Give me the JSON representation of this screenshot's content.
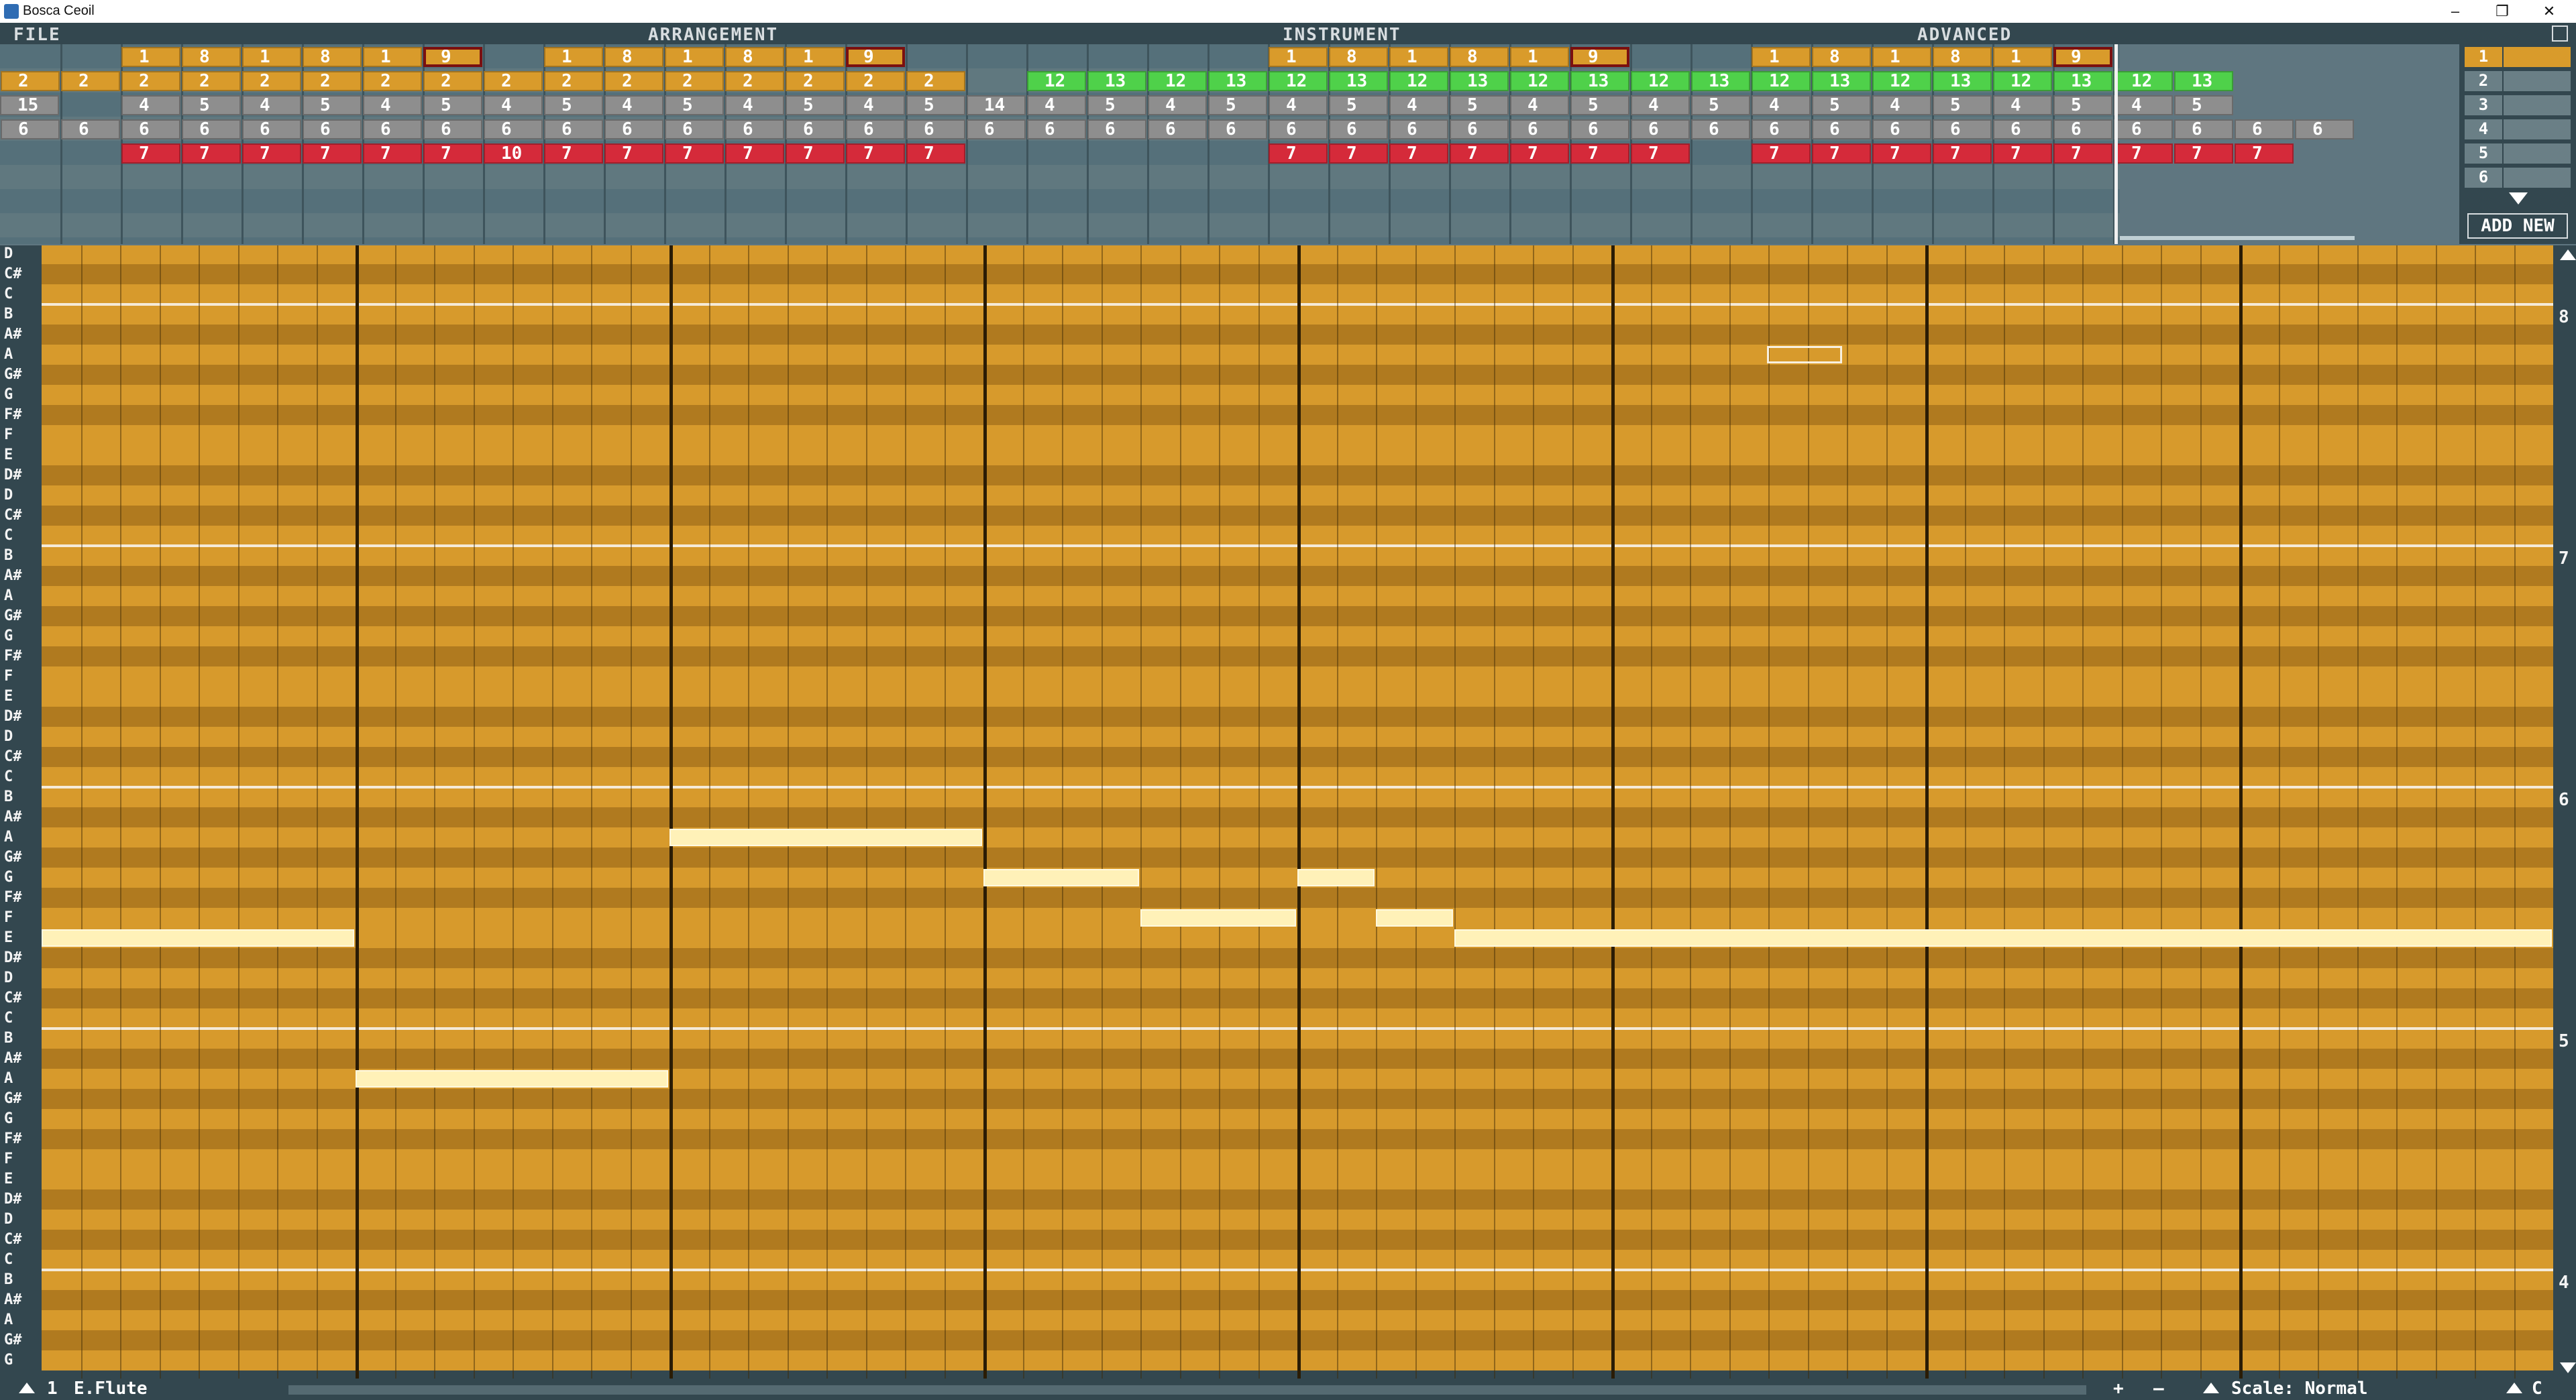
{
  "window": {
    "title": "Bosca Ceoil",
    "minimize": "–",
    "restore": "❐",
    "close": "✕"
  },
  "menu": {
    "file": "FILE",
    "arrangement": "ARRANGEMENT",
    "instrument": "INSTRUMENT",
    "advanced": "ADVANCED"
  },
  "arrangement": {
    "rows": [
      {
        "cells": [
          {
            "t": "1",
            "c": "orange"
          },
          {
            "t": "8",
            "c": "orange"
          },
          {
            "t": "1",
            "c": "orange"
          },
          {
            "t": "8",
            "c": "orange"
          },
          {
            "t": "1",
            "c": "orange"
          },
          {
            "t": "9",
            "c": "orange",
            "sel": true
          },
          {
            "t": "1",
            "c": "orange"
          },
          {
            "t": "8",
            "c": "orange"
          },
          {
            "t": "1",
            "c": "orange"
          },
          {
            "t": "8",
            "c": "orange"
          },
          {
            "t": "1",
            "c": "orange"
          },
          {
            "t": "9",
            "c": "orange",
            "sel": true
          },
          {
            "t": "1",
            "c": "orange"
          },
          {
            "t": "8",
            "c": "orange"
          },
          {
            "t": "1",
            "c": "orange"
          },
          {
            "t": "8",
            "c": "orange"
          },
          {
            "t": "1",
            "c": "orange"
          },
          {
            "t": "9",
            "c": "orange",
            "sel": true
          },
          {
            "t": "1",
            "c": "orange"
          },
          {
            "t": "8",
            "c": "orange"
          },
          {
            "t": "1",
            "c": "orange"
          },
          {
            "t": "8",
            "c": "orange"
          },
          {
            "t": "1",
            "c": "orange"
          },
          {
            "t": "9",
            "c": "orange",
            "sel": true
          }
        ]
      },
      {
        "cells": [
          {
            "t": "2",
            "c": "orange"
          },
          {
            "t": "2",
            "c": "orange"
          },
          {
            "t": "2",
            "c": "orange"
          },
          {
            "t": "2",
            "c": "orange"
          },
          {
            "t": "2",
            "c": "orange"
          },
          {
            "t": "2",
            "c": "orange"
          },
          {
            "t": "2",
            "c": "orange"
          },
          {
            "t": "2",
            "c": "orange"
          },
          {
            "t": "2",
            "c": "orange"
          },
          {
            "t": "2",
            "c": "orange"
          },
          {
            "t": "2",
            "c": "orange"
          },
          {
            "t": "2",
            "c": "orange"
          },
          {
            "t": "2",
            "c": "orange"
          },
          {
            "t": "2",
            "c": "orange"
          },
          {
            "t": "2",
            "c": "orange"
          },
          {
            "t": "2",
            "c": "orange"
          },
          {
            "t": "12",
            "c": "green"
          },
          {
            "t": "13",
            "c": "green"
          },
          {
            "t": "12",
            "c": "green"
          },
          {
            "t": "13",
            "c": "green"
          },
          {
            "t": "12",
            "c": "green"
          },
          {
            "t": "13",
            "c": "green"
          },
          {
            "t": "12",
            "c": "green"
          },
          {
            "t": "13",
            "c": "green"
          },
          {
            "t": "12",
            "c": "green"
          },
          {
            "t": "13",
            "c": "green"
          },
          {
            "t": "12",
            "c": "green"
          },
          {
            "t": "13",
            "c": "green"
          },
          {
            "t": "12",
            "c": "green"
          },
          {
            "t": "13",
            "c": "green"
          },
          {
            "t": "12",
            "c": "green"
          },
          {
            "t": "13",
            "c": "green"
          },
          {
            "t": "12",
            "c": "green"
          },
          {
            "t": "13",
            "c": "green"
          },
          {
            "t": "12",
            "c": "green"
          },
          {
            "t": "13",
            "c": "green"
          }
        ]
      },
      {
        "cells": [
          {
            "t": "4",
            "c": "gray"
          },
          {
            "t": "5",
            "c": "gray"
          },
          {
            "t": "4",
            "c": "gray"
          },
          {
            "t": "5",
            "c": "gray"
          },
          {
            "t": "4",
            "c": "gray"
          },
          {
            "t": "5",
            "c": "gray"
          },
          {
            "t": "4",
            "c": "gray"
          },
          {
            "t": "5",
            "c": "gray"
          },
          {
            "t": "4",
            "c": "gray"
          },
          {
            "t": "5",
            "c": "gray"
          },
          {
            "t": "4",
            "c": "gray"
          },
          {
            "t": "5",
            "c": "gray"
          },
          {
            "t": "4",
            "c": "gray"
          },
          {
            "t": "5",
            "c": "gray"
          },
          {
            "t": "14",
            "c": "gray"
          },
          {
            "t": "4",
            "c": "gray"
          },
          {
            "t": "5",
            "c": "gray"
          },
          {
            "t": "4",
            "c": "gray"
          },
          {
            "t": "5",
            "c": "gray"
          },
          {
            "t": "4",
            "c": "gray"
          },
          {
            "t": "5",
            "c": "gray"
          },
          {
            "t": "4",
            "c": "gray"
          },
          {
            "t": "5",
            "c": "gray"
          },
          {
            "t": "4",
            "c": "gray"
          },
          {
            "t": "5",
            "c": "gray"
          },
          {
            "t": "4",
            "c": "gray"
          },
          {
            "t": "5",
            "c": "gray"
          },
          {
            "t": "4",
            "c": "gray"
          },
          {
            "t": "5",
            "c": "gray"
          },
          {
            "t": "4",
            "c": "gray"
          },
          {
            "t": "5",
            "c": "gray"
          },
          {
            "t": "4",
            "c": "gray"
          },
          {
            "t": "5",
            "c": "gray"
          },
          {
            "t": "4",
            "c": "gray"
          },
          {
            "t": "5",
            "c": "gray"
          },
          {
            "t": "15",
            "c": "gray"
          }
        ]
      },
      {
        "cells": [
          {
            "t": "6",
            "c": "gray"
          },
          {
            "t": "6",
            "c": "gray"
          },
          {
            "t": "6",
            "c": "gray"
          },
          {
            "t": "6",
            "c": "gray"
          },
          {
            "t": "6",
            "c": "gray"
          },
          {
            "t": "6",
            "c": "gray"
          },
          {
            "t": "6",
            "c": "gray"
          },
          {
            "t": "6",
            "c": "gray"
          },
          {
            "t": "6",
            "c": "gray"
          },
          {
            "t": "6",
            "c": "gray"
          },
          {
            "t": "6",
            "c": "gray"
          },
          {
            "t": "6",
            "c": "gray"
          },
          {
            "t": "6",
            "c": "gray"
          },
          {
            "t": "6",
            "c": "gray"
          },
          {
            "t": "6",
            "c": "gray"
          },
          {
            "t": "6",
            "c": "gray"
          },
          {
            "t": "6",
            "c": "gray"
          },
          {
            "t": "6",
            "c": "gray"
          },
          {
            "t": "6",
            "c": "gray"
          },
          {
            "t": "6",
            "c": "gray"
          },
          {
            "t": "6",
            "c": "gray"
          },
          {
            "t": "6",
            "c": "gray"
          },
          {
            "t": "6",
            "c": "gray"
          },
          {
            "t": "6",
            "c": "gray"
          },
          {
            "t": "6",
            "c": "gray"
          },
          {
            "t": "6",
            "c": "gray"
          },
          {
            "t": "6",
            "c": "gray"
          },
          {
            "t": "6",
            "c": "gray"
          },
          {
            "t": "6",
            "c": "gray"
          },
          {
            "t": "6",
            "c": "gray"
          },
          {
            "t": "6",
            "c": "gray"
          },
          {
            "t": "6",
            "c": "gray"
          },
          {
            "t": "6",
            "c": "gray"
          },
          {
            "t": "6",
            "c": "gray"
          },
          {
            "t": "6",
            "c": "gray"
          },
          {
            "t": "6",
            "c": "gray"
          },
          {
            "t": "6",
            "c": "gray"
          },
          {
            "t": "6",
            "c": "gray"
          },
          {
            "t": "6",
            "c": "gray"
          }
        ]
      },
      {
        "cells": [
          {
            "t": "7",
            "c": "red"
          },
          {
            "t": "7",
            "c": "red"
          },
          {
            "t": "7",
            "c": "red"
          },
          {
            "t": "7",
            "c": "red"
          },
          {
            "t": "7",
            "c": "red"
          },
          {
            "t": "7",
            "c": "red"
          },
          {
            "t": "10",
            "c": "red"
          },
          {
            "t": "7",
            "c": "red"
          },
          {
            "t": "7",
            "c": "red"
          },
          {
            "t": "7",
            "c": "red"
          },
          {
            "t": "7",
            "c": "red"
          },
          {
            "t": "7",
            "c": "red"
          },
          {
            "t": "7",
            "c": "red"
          },
          {
            "t": "7",
            "c": "red"
          },
          {
            "t": "7",
            "c": "red"
          },
          {
            "t": "7",
            "c": "red"
          },
          {
            "t": "7",
            "c": "red"
          },
          {
            "t": "7",
            "c": "red"
          },
          {
            "t": "7",
            "c": "red"
          },
          {
            "t": "7",
            "c": "red"
          },
          {
            "t": "7",
            "c": "red"
          },
          {
            "t": "7",
            "c": "red"
          },
          {
            "t": "7",
            "c": "red"
          },
          {
            "t": "7",
            "c": "red"
          },
          {
            "t": "7",
            "c": "red"
          },
          {
            "t": "7",
            "c": "red"
          },
          {
            "t": "7",
            "c": "red"
          },
          {
            "t": "7",
            "c": "red"
          },
          {
            "t": "7",
            "c": "red"
          },
          {
            "t": "7",
            "c": "red"
          }
        ]
      }
    ]
  },
  "instruments": {
    "items": [
      "1",
      "2",
      "3",
      "4",
      "5",
      "6"
    ],
    "add_new": "ADD NEW"
  },
  "piano": {
    "octave_numbers": [
      "8",
      "7",
      "6",
      "5",
      "4"
    ],
    "notes_top": [
      "D",
      "C#",
      "C"
    ],
    "note_names": [
      "B",
      "A#",
      "A",
      "G#",
      "G",
      "F#",
      "F",
      "E",
      "D#",
      "D",
      "C#",
      "C"
    ],
    "notes_bottom": [
      "B",
      "A#",
      "A",
      "G#",
      "G"
    ]
  },
  "notes": [
    {
      "pitch": "E6",
      "start": 0,
      "length": 8
    },
    {
      "pitch": "A5",
      "start": 8,
      "length": 8
    },
    {
      "pitch": "A6",
      "start": 16,
      "length": 8
    },
    {
      "pitch": "G6",
      "start": 24,
      "length": 4
    },
    {
      "pitch": "F6",
      "start": 28,
      "length": 4
    },
    {
      "pitch": "G6",
      "start": 32,
      "length": 2
    },
    {
      "pitch": "F6",
      "start": 34,
      "length": 2
    },
    {
      "pitch": "E6",
      "start": 36,
      "length": 28
    }
  ],
  "bottom": {
    "instrument_num": "1",
    "instrument_name": "E.Flute",
    "plus": "+",
    "minus": "–",
    "scale": "Scale: Normal",
    "key": "C"
  },
  "colors": {
    "orange": "#d99b2b",
    "green": "#4fd14a",
    "gray": "#8e8e8e",
    "red": "#d52a3a",
    "note": "#fff1b8"
  }
}
